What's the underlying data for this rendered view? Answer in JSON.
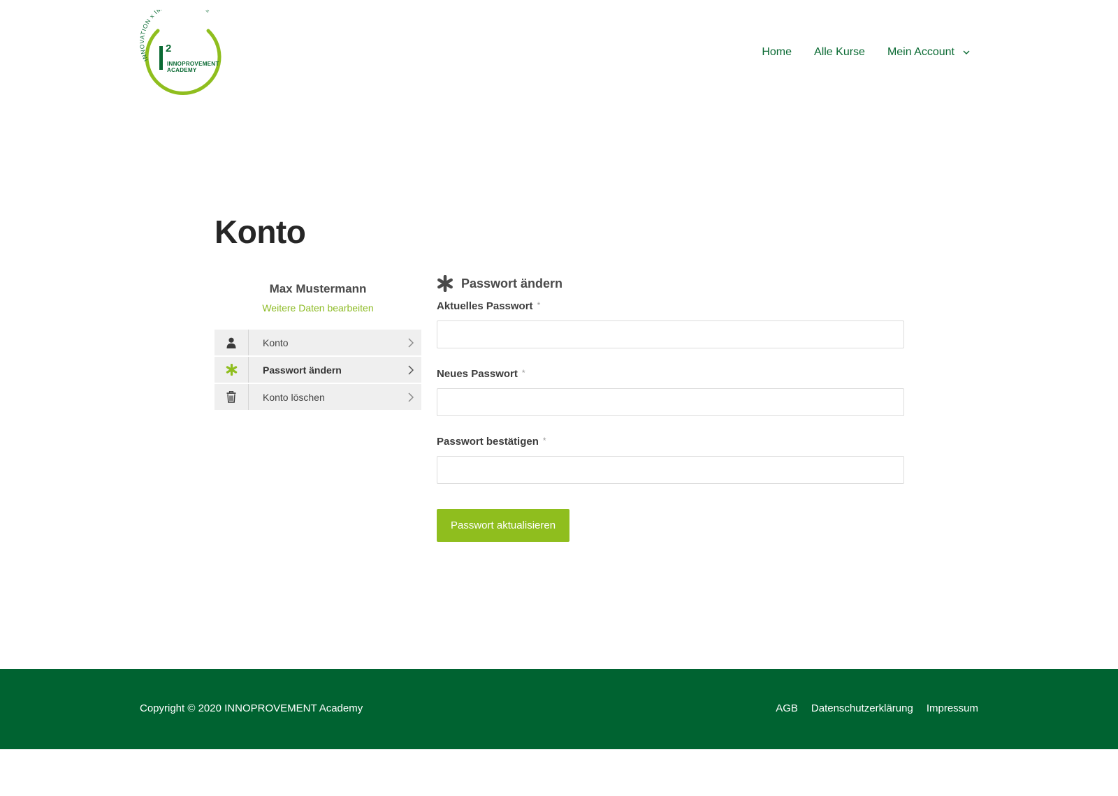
{
  "logo": {
    "ring_text": "INNOVATION x IMPROVEMENT =",
    "mark": "I",
    "superscript": "2",
    "line1": "INNOPROVEMENT",
    "line2": "ACADEMY"
  },
  "nav": {
    "items": [
      {
        "label": "Home"
      },
      {
        "label": "Alle Kurse"
      },
      {
        "label": "Mein Account",
        "has_dropdown": true
      }
    ]
  },
  "page": {
    "title": "Konto"
  },
  "sidebar": {
    "user_name": "Max Mustermann",
    "edit_link": "Weitere Daten bearbeiten",
    "items": [
      {
        "label": "Konto",
        "icon": "user-icon",
        "active": false
      },
      {
        "label": "Passwort ändern",
        "icon": "asterisk-icon",
        "active": true
      },
      {
        "label": "Konto löschen",
        "icon": "trash-icon",
        "active": false
      }
    ]
  },
  "form": {
    "heading": "Passwort ändern",
    "fields": [
      {
        "label": "Aktuelles Passwort",
        "required_mark": "*",
        "value": ""
      },
      {
        "label": "Neues Passwort",
        "required_mark": "*",
        "value": ""
      },
      {
        "label": "Passwort bestätigen",
        "required_mark": "*",
        "value": ""
      }
    ],
    "submit_label": "Passwort aktualisieren"
  },
  "footer": {
    "copyright": "Copyright © 2020 INNOPROVEMENT Academy",
    "links": [
      {
        "label": "AGB"
      },
      {
        "label": "Datenschutzerklärung"
      },
      {
        "label": "Impressum"
      }
    ]
  },
  "colors": {
    "brand_dark_green": "#006331",
    "accent_green": "#8fbe1e",
    "nav_green": "#0a6a33"
  }
}
